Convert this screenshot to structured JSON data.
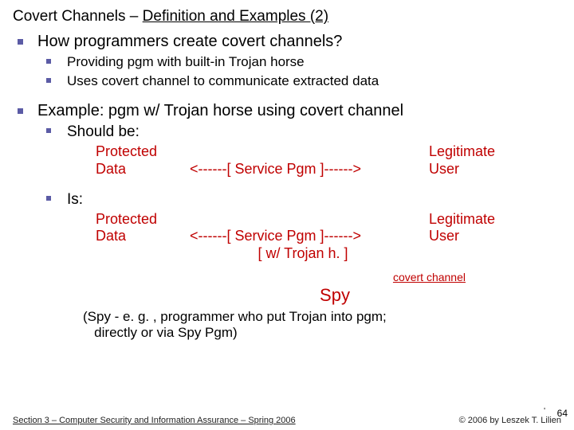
{
  "title_prefix": "Covert Channels – ",
  "title_underline": "Definition and Examples (2)",
  "p1": "How programmers create covert channels?",
  "p1a": "Providing pgm with built-in Trojan horse",
  "p1b": "Uses covert channel to communicate extracted data",
  "p2": "Example: pgm w/ Trojan horse using covert channel",
  "p2a": "Should be:",
  "diag1": {
    "left1": "Protected",
    "left2": "Data",
    "mid": "<------[ Service Pgm ]------>",
    "right1": "Legitimate",
    "right2": "User"
  },
  "p2b": "Is:",
  "diag2": {
    "left1": "Protected",
    "left2": "Data",
    "mid1": "<------[ Service Pgm ]------>",
    "mid2": "[ w/ Trojan h. ]",
    "right1": "Legitimate",
    "right2": "User"
  },
  "covert_label": "covert channel",
  "spy": "Spy",
  "note1": "(Spy - e. g. , programmer who put Trojan into pgm;",
  "note2": "directly or via Spy Pgm)",
  "footer_left": "Section 3 – Computer Security and Information Assurance – Spring 2006",
  "footer_right": "© 2006 by Leszek T. Lilien",
  "page_number": "64"
}
